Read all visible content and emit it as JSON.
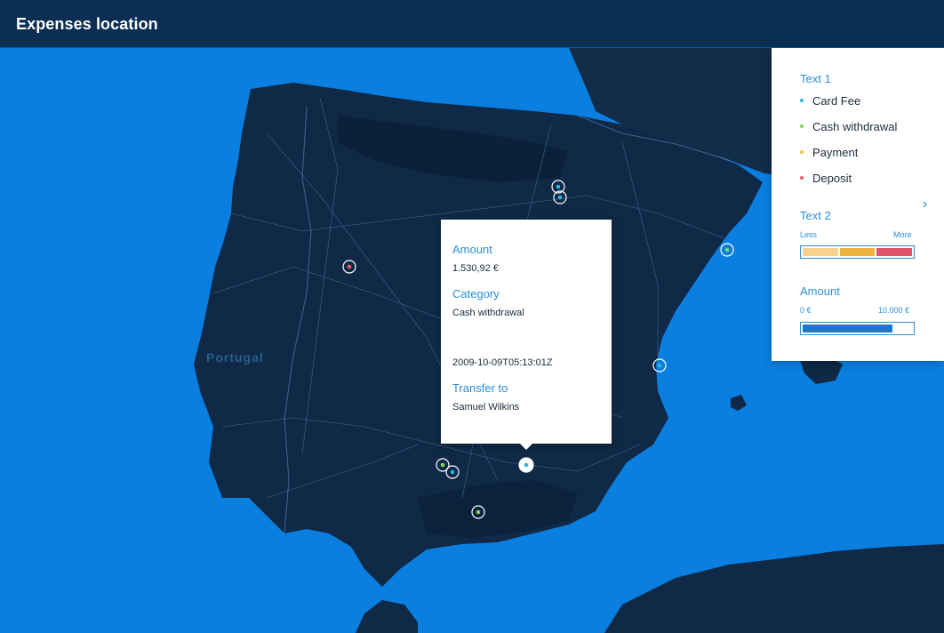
{
  "header": {
    "title": "Expenses location"
  },
  "map": {
    "labels": [
      {
        "name": "country-label-portugal",
        "text": "Portugal"
      }
    ],
    "markers": [
      {
        "category": "Card Fee"
      },
      {
        "category": "Card Fee"
      },
      {
        "category": "Deposit"
      },
      {
        "category": "Cash withdrawal"
      },
      {
        "category": "Card Fee"
      },
      {
        "category": "Cash withdrawal"
      },
      {
        "category": "Card Fee"
      },
      {
        "category": "Cash withdrawal"
      },
      {
        "category": "Card Fee",
        "selected": true
      }
    ]
  },
  "popup": {
    "amount_label": "Amount",
    "amount_value": "1.530,92 €",
    "category_label": "Category",
    "category_value": "Cash withdrawal",
    "date_value": "2009-10-09T05:13:01Z",
    "transfer_label": "Transfer to",
    "transfer_value": "Samuel Wilkins"
  },
  "legend": {
    "text1_title": "Text 1",
    "items": [
      {
        "label": "Card Fee",
        "color": "#29b6e0"
      },
      {
        "label": "Cash withdrawal",
        "color": "#7ed957"
      },
      {
        "label": "Payment",
        "color": "#f5c04a"
      },
      {
        "label": "Deposit",
        "color": "#ee5a6a"
      }
    ],
    "text2_title": "Text 2",
    "less_label": "Less",
    "more_label": "More",
    "scale_colors": [
      "#f8d28a",
      "#f0b23e",
      "#e0536a"
    ],
    "amount_title": "Amount",
    "amount_min": "0 €",
    "amount_max": "10.000 €",
    "amount_fill_fraction": 0.82,
    "amount_bar_color": "#1a78d0"
  },
  "colors": {
    "sea": "#0a7fe0",
    "land": "#102a48",
    "land_dark": "#0b2039",
    "roads": "#3d6a94",
    "header": "#0b2e52"
  }
}
